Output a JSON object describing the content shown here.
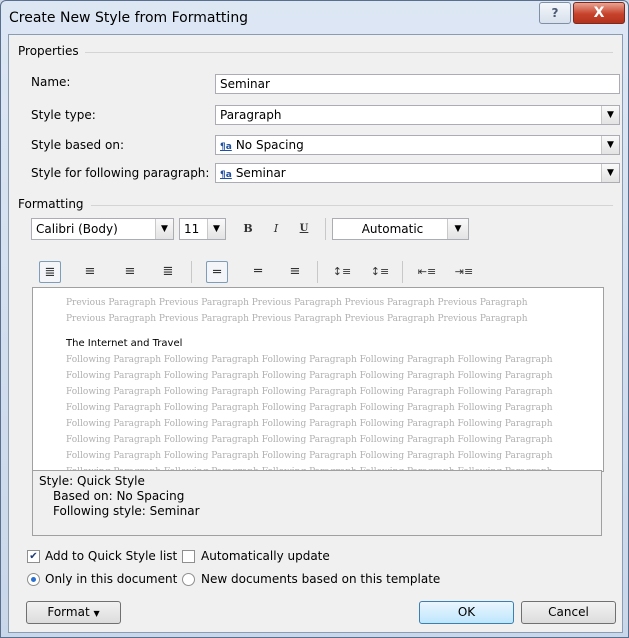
{
  "window": {
    "title": "Create New Style from Formatting",
    "help_label": "?",
    "close_label": "X"
  },
  "properties": {
    "group_label": "Properties",
    "name_label": "Name:",
    "name_value": "Seminar",
    "style_type_label": "Style type:",
    "style_type_value": "Paragraph",
    "based_on_label": "Style based on:",
    "based_on_value": "No Spacing",
    "following_label": "Style for following paragraph:",
    "following_value": "Seminar"
  },
  "formatting": {
    "group_label": "Formatting",
    "font": "Calibri (Body)",
    "size": "11",
    "bold": "B",
    "italic": "I",
    "underline": "U",
    "color": "Automatic"
  },
  "preview": {
    "previous_text": "Previous Paragraph Previous Paragraph Previous Paragraph Previous Paragraph Previous Paragraph Previous Paragraph Previous Paragraph Previous Paragraph Previous Paragraph Previous Paragraph",
    "sample_text": "The Internet and Travel",
    "following_line": "Following Paragraph Following Paragraph Following Paragraph Following Paragraph Following Paragraph"
  },
  "description": {
    "line1": "Style: Quick Style",
    "line2": "Based on: No Spacing",
    "line3": "Following style: Seminar"
  },
  "options": {
    "add_quick_style": "Add to Quick Style list",
    "auto_update": "Automatically update",
    "only_this_doc": "Only in this document",
    "new_docs": "New documents based on this template"
  },
  "buttons": {
    "format": "Format",
    "ok": "OK",
    "cancel": "Cancel"
  },
  "colors": {
    "accent": "#3c7fb1",
    "close": "#c7422b",
    "preview_text": "#b0b0b0"
  }
}
